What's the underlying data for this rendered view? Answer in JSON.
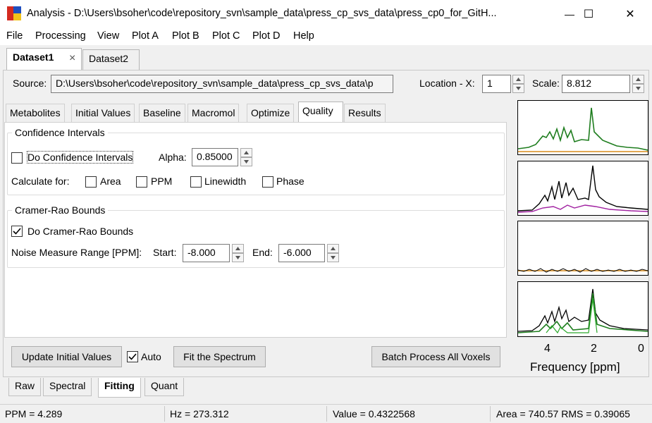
{
  "window": {
    "title": "Analysis - D:\\Users\\bsoher\\code\\repository_svn\\sample_data\\press_cp_svs_data\\press_cp0_for_GitH...",
    "minimize_glyph": "—",
    "maximize_glyph": "☐",
    "close_glyph": "✕"
  },
  "menu": [
    {
      "label": "File"
    },
    {
      "label": "Processing"
    },
    {
      "label": "View"
    },
    {
      "label": "Plot A"
    },
    {
      "label": "Plot B"
    },
    {
      "label": "Plot C"
    },
    {
      "label": "Plot D"
    },
    {
      "label": "Help"
    }
  ],
  "dataset_tabs": [
    {
      "label": "Dataset1",
      "active": true,
      "close_glyph": "×"
    },
    {
      "label": "Dataset2",
      "active": false
    }
  ],
  "source": {
    "label": "Source:",
    "value": "D:\\Users\\bsoher\\code\\repository_svn\\sample_data\\press_cp_svs_data\\p",
    "location_label": "Location - X:",
    "location_value": "1",
    "scale_label": "Scale:",
    "scale_value": "8.812"
  },
  "sub_tabs": [
    {
      "label": "Metabolites"
    },
    {
      "label": "Initial Values"
    },
    {
      "label": "Baseline"
    },
    {
      "label": "Macromol"
    },
    {
      "label": "Optimize"
    },
    {
      "label": "Quality",
      "active": true
    },
    {
      "label": "Results"
    }
  ],
  "confidence": {
    "group_title": "Confidence Intervals",
    "do_label": "Do Confidence Intervals",
    "do_checked": false,
    "alpha_label": "Alpha:",
    "alpha_value": "0.85000",
    "calc_label": "Calculate for:",
    "options": [
      {
        "label": "Area",
        "checked": false
      },
      {
        "label": "PPM",
        "checked": false
      },
      {
        "label": "Linewidth",
        "checked": false
      },
      {
        "label": "Phase",
        "checked": false
      }
    ]
  },
  "cramer": {
    "group_title": "Cramer-Rao Bounds",
    "do_label": "Do Cramer-Rao Bounds",
    "do_checked": true,
    "noise_label": "Noise Measure Range [PPM]:",
    "start_label": "Start:",
    "start_value": "-8.000",
    "end_label": "End:",
    "end_value": "-6.000"
  },
  "actions": {
    "update_label": "Update Initial Values",
    "auto_label": "Auto",
    "auto_checked": true,
    "fit_label": "Fit the Spectrum",
    "batch_label": "Batch Process All Voxels"
  },
  "plot_axis": {
    "ticks": [
      "4",
      "2",
      "0"
    ],
    "xlabel": "Frequency [ppm]"
  },
  "bottom_tabs": [
    {
      "label": "Raw"
    },
    {
      "label": "Spectral"
    },
    {
      "label": "Fitting",
      "active": true
    },
    {
      "label": "Quant"
    }
  ],
  "status": {
    "ppm": "PPM = 4.289",
    "hz": "Hz = 273.312",
    "value": "Value = 0.4322568",
    "area": "Area = 740.57  RMS = 0.39065"
  },
  "colors": {
    "green": "#1e7d1e",
    "orange": "#d98c1a",
    "purple": "#a020a0",
    "black": "#000000"
  }
}
